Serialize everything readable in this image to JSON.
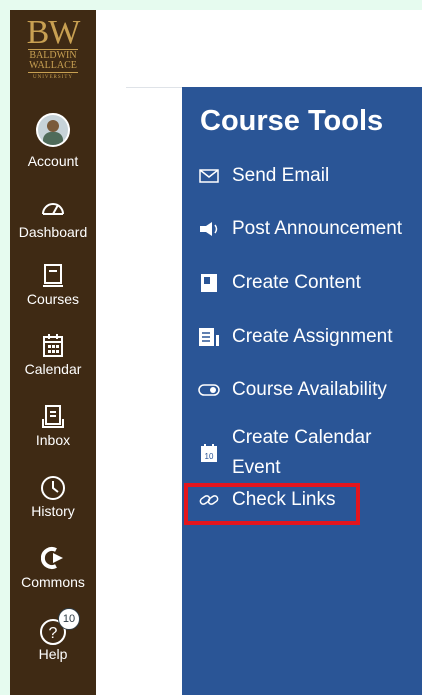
{
  "logo": {
    "initials": "BW",
    "line1": "BALDWIN",
    "line2": "WALLACE",
    "line3": "UNIVERSITY"
  },
  "nav": [
    {
      "label": "Account",
      "icon": "avatar"
    },
    {
      "label": "Dashboard",
      "icon": "dashboard-icon"
    },
    {
      "label": "Courses",
      "icon": "courses-icon"
    },
    {
      "label": "Calendar",
      "icon": "calendar-icon"
    },
    {
      "label": "Inbox",
      "icon": "inbox-icon"
    },
    {
      "label": "History",
      "icon": "history-icon"
    },
    {
      "label": "Commons",
      "icon": "commons-icon"
    },
    {
      "label": "Help",
      "icon": "help-icon",
      "badge": "10"
    }
  ],
  "course_tools": {
    "title": "Course Tools",
    "items": [
      {
        "label": "Send Email",
        "icon": "email-icon"
      },
      {
        "label": "Post Announcement",
        "icon": "announcement-icon"
      },
      {
        "label": "Create Content",
        "icon": "content-icon"
      },
      {
        "label": "Create Assignment",
        "icon": "assignment-icon"
      },
      {
        "label": "Course Availability",
        "icon": "toggle-icon"
      },
      {
        "label_line1": "Create Calendar",
        "label_line2": "Event",
        "icon": "calendar-event-icon",
        "icon_text": "10"
      },
      {
        "label": "Check Links",
        "icon": "link-icon",
        "highlighted": true
      }
    ]
  },
  "colors": {
    "sidebar": "#3f2a14",
    "panel": "#2a5596",
    "highlight": "#e3151d",
    "background": "#e6fbef"
  }
}
